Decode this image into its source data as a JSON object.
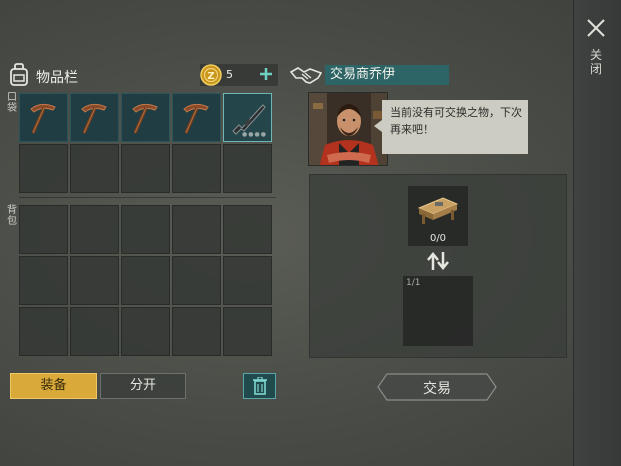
{
  "close": {
    "label": "关闭",
    "icon": "close-icon"
  },
  "inventory": {
    "icon": "backpack-icon",
    "title": "物品栏",
    "coins": "5",
    "coin_icon": "coin-icon",
    "add_icon": "plus-icon",
    "pocket_tag": "口袋",
    "backpack_tag": "背包",
    "pocket_slots": [
      {
        "item": "pickaxe",
        "icon": "pickaxe-icon"
      },
      {
        "item": "pickaxe",
        "icon": "pickaxe-icon"
      },
      {
        "item": "pickaxe",
        "icon": "pickaxe-icon"
      },
      {
        "item": "pickaxe",
        "icon": "pickaxe-icon"
      },
      {
        "item": "rifle",
        "icon": "rifle-icon",
        "selected": true
      },
      {},
      {},
      {},
      {},
      {}
    ],
    "backpack_rows": 3,
    "backpack_cols": 5
  },
  "buttons": {
    "equip": "装备",
    "split": "分开",
    "trash_icon": "trash-icon"
  },
  "trader": {
    "icon": "handshake-icon",
    "name": "交易商乔伊",
    "message": "当前没有可交换之物，下次再来吧！",
    "offer_icon": "workbench-icon",
    "offer_count": "0/0",
    "receive_count": "1/1",
    "trade_button": "交易"
  },
  "colors": {
    "accent_teal": "#2d6466",
    "equip_yellow": "#d9a93a"
  }
}
